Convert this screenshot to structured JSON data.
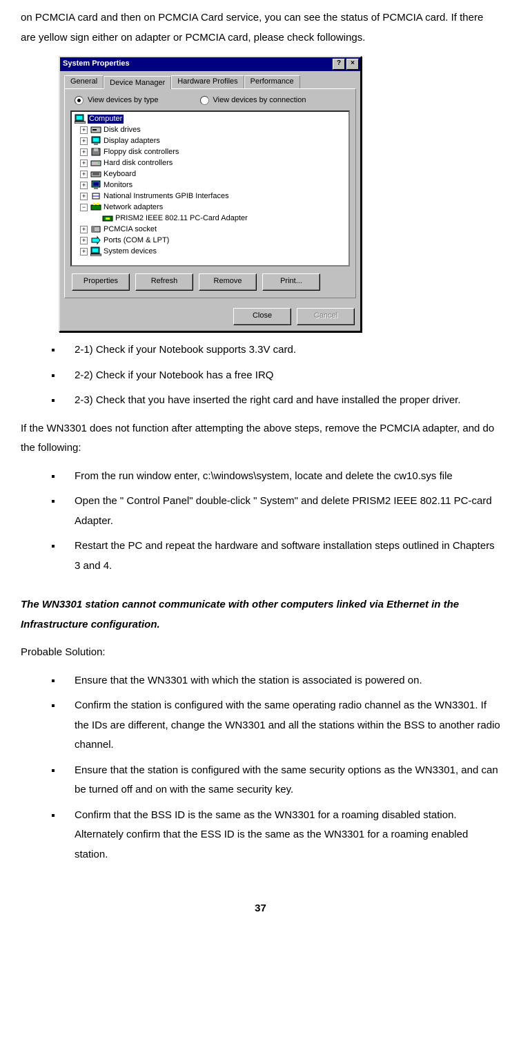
{
  "intro_para": "on PCMCIA card and then on PCMCIA Card service, you can see the status of PCMCIA card. If there are yellow sign either on adapter or PCMCIA card, please check followings.",
  "dialog": {
    "title": "System Properties",
    "help_btn": "?",
    "close_btn": "×",
    "tabs": [
      "General",
      "Device Manager",
      "Hardware Profiles",
      "Performance"
    ],
    "radio_type": "View devices by type",
    "radio_conn": "View devices by connection",
    "tree": {
      "root": "Computer",
      "items": [
        "Disk drives",
        "Display adapters",
        "Floppy disk controllers",
        "Hard disk controllers",
        "Keyboard",
        "Monitors",
        "National Instruments GPIB Interfaces",
        "Network adapters",
        "PCMCIA socket",
        "Ports (COM & LPT)",
        "System devices"
      ],
      "net_child": "PRISM2 IEEE 802.11 PC-Card Adapter"
    },
    "buttons": {
      "properties": "Properties",
      "refresh": "Refresh",
      "remove": "Remove",
      "print": "Print...",
      "close": "Close",
      "cancel": "Cancel"
    }
  },
  "list_a": [
    "2-1) Check if your Notebook supports 3.3V card.",
    "2-2) Check if your Notebook has a free IRQ",
    "2-3) Check that you have inserted the right card and have installed the proper driver."
  ],
  "mid_para": "If the WN3301 does not function after attempting the above steps, remove the PCMCIA adapter, and do the following:",
  "list_b": [
    "From the run window enter, c:\\windows\\system, locate and delete the cw10.sys file",
    "Open the \" Control Panel\"  double-click \" System\"  and delete PRISM2 IEEE 802.11 PC-card Adapter.",
    "Restart the PC and repeat the hardware and software installation steps outlined in Chapters 3 and 4."
  ],
  "heading": "The WN3301 station cannot communicate with other computers linked via Ethernet in the Infrastructure configuration.",
  "probable": "Probable Solution:",
  "list_c": [
    "Ensure that the WN3301 with which the station is associated is powered on.",
    "Confirm the station is configured with the same operating radio channel as the WN3301. If the IDs are different, change the WN3301 and all the stations within the BSS to another radio channel.",
    "Ensure that the station is configured with the same security options as the WN3301, and can be turned off and on with the same security key.",
    "Confirm that the BSS ID is the same as the WN3301 for a roaming disabled station. Alternately confirm that the ESS ID is the same as the WN3301 for a roaming enabled station."
  ],
  "page_number": "37"
}
